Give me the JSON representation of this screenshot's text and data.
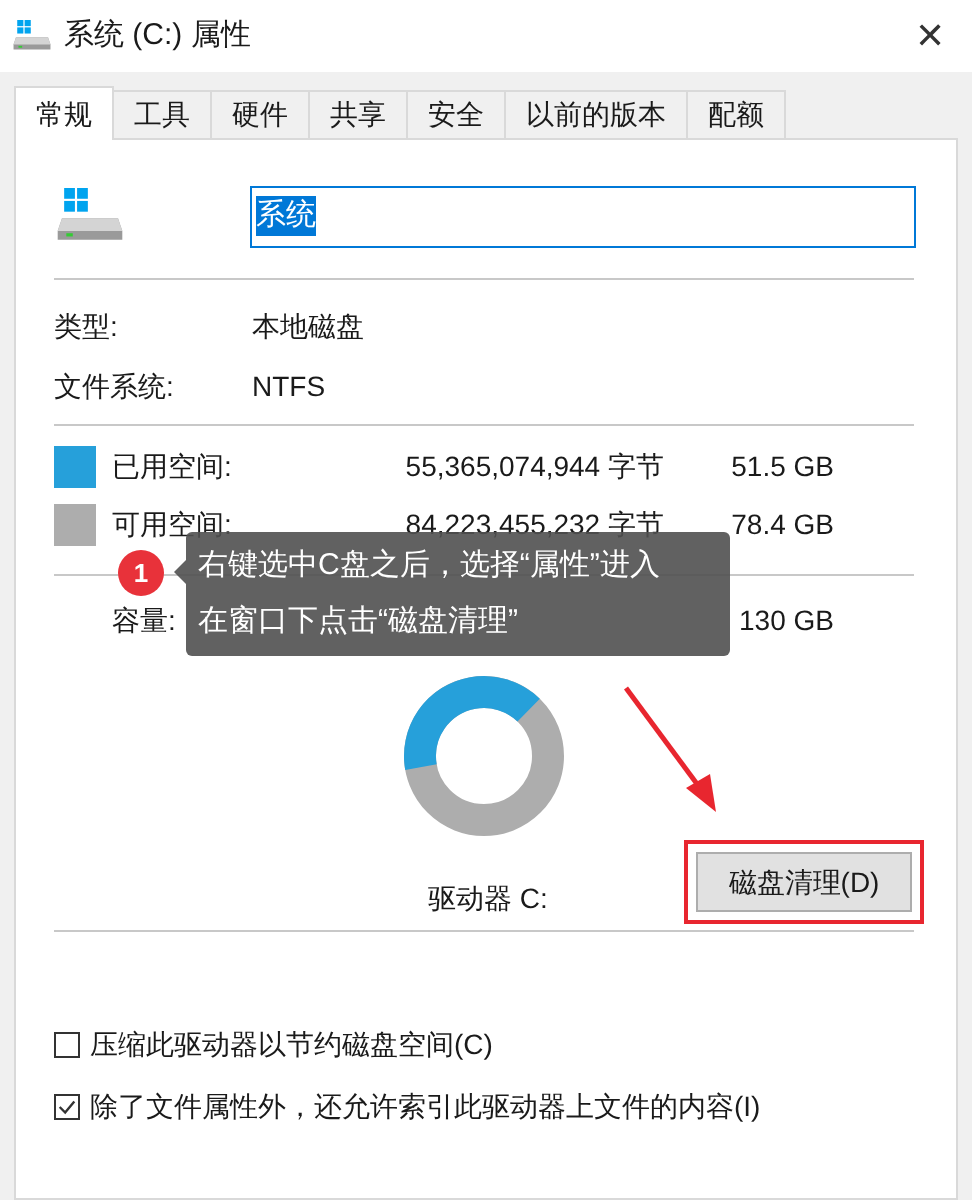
{
  "window": {
    "title": "系统 (C:) 属性",
    "close": "✕"
  },
  "tabs": [
    {
      "label": "常规",
      "selected": true
    },
    {
      "label": "工具",
      "selected": false
    },
    {
      "label": "硬件",
      "selected": false
    },
    {
      "label": "共享",
      "selected": false
    },
    {
      "label": "安全",
      "selected": false
    },
    {
      "label": "以前的版本",
      "selected": false
    },
    {
      "label": "配额",
      "selected": false
    }
  ],
  "drive_name": {
    "value": "系统"
  },
  "info": [
    {
      "label": "类型:",
      "value": "本地磁盘"
    },
    {
      "label": "文件系统:",
      "value": "NTFS"
    }
  ],
  "space": [
    {
      "label": "已用空间:",
      "bytes": "55,365,074,944 字节",
      "size": "51.5 GB",
      "color": "#26a0da"
    },
    {
      "label": "可用空间:",
      "bytes": "84,223,455,232 字节",
      "size": "78.4 GB",
      "color": "#adadad"
    }
  ],
  "capacity": {
    "label": "容量:",
    "size": "130 GB"
  },
  "usage_ring": {
    "level": 0.4
  },
  "drive_label": "驱动器 C:",
  "cleanup_button": {
    "label": "磁盘清理(D)",
    "highlighted": true
  },
  "options": [
    {
      "label": "压缩此驱动器以节约磁盘空间(C)",
      "checked": false
    },
    {
      "label": "除了文件属性外，还允许索引此驱动器上文件的内容(I)",
      "checked": true
    }
  ],
  "annotation": {
    "step": "1",
    "lines": [
      "右键选中C盘之后，选择“属性”进入",
      "在窗口下点击“磁盘清理”"
    ]
  }
}
